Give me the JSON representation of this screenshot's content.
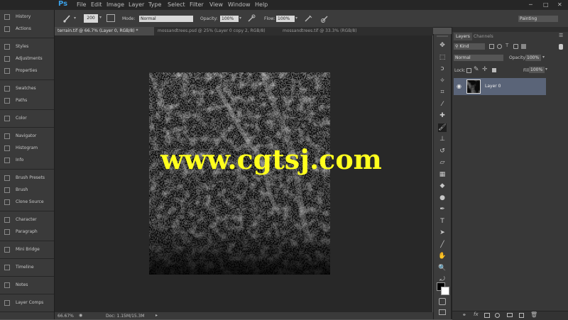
{
  "app": {
    "logo": "Ps"
  },
  "menu": [
    "File",
    "Edit",
    "Image",
    "Layer",
    "Type",
    "Select",
    "Filter",
    "View",
    "Window",
    "Help"
  ],
  "options": {
    "brush_size": "200",
    "mode_label": "Mode:",
    "mode_value": "Normal",
    "opacity_label": "Opacity:",
    "opacity_value": "100%",
    "flow_label": "Flow:",
    "flow_value": "100%",
    "workspace": "Painting"
  },
  "left_panel": {
    "items": [
      {
        "label": "History",
        "icon": "history-icon"
      },
      {
        "label": "Actions",
        "icon": "actions-icon"
      },
      {
        "label": "Styles",
        "icon": "styles-icon"
      },
      {
        "label": "Adjustments",
        "icon": "adjustments-icon"
      },
      {
        "label": "Properties",
        "icon": "properties-icon"
      },
      {
        "label": "Swatches",
        "icon": "swatches-icon"
      },
      {
        "label": "Paths",
        "icon": "paths-icon"
      },
      {
        "label": "Color",
        "icon": "color-icon"
      },
      {
        "label": "Navigator",
        "icon": "navigator-icon"
      },
      {
        "label": "Histogram",
        "icon": "histogram-icon"
      },
      {
        "label": "Info",
        "icon": "info-icon"
      },
      {
        "label": "Brush Presets",
        "icon": "brush-presets-icon"
      },
      {
        "label": "Brush",
        "icon": "brush-icon"
      },
      {
        "label": "Clone Source",
        "icon": "clone-source-icon"
      },
      {
        "label": "Character",
        "icon": "character-icon"
      },
      {
        "label": "Paragraph",
        "icon": "paragraph-icon"
      },
      {
        "label": "Mini Bridge",
        "icon": "mini-bridge-icon"
      },
      {
        "label": "Timeline",
        "icon": "timeline-icon"
      },
      {
        "label": "Notes",
        "icon": "notes-icon"
      },
      {
        "label": "Layer Comps",
        "icon": "layer-comps-icon"
      }
    ]
  },
  "tabs": [
    {
      "label": "terrain.tif @ 66.7% (Layer 0, RGB/8) *",
      "active": true
    },
    {
      "label": "mossandtrees.psd @ 25% (Layer 0 copy 2, RGB/8)",
      "active": false
    },
    {
      "label": "mossandtrees.tif @ 33.3% (RGB/8)",
      "active": false
    }
  ],
  "canvas": {
    "watermark": "www.cgtsj.com"
  },
  "status": {
    "zoom": "66.67%",
    "doc": "Doc: 1.15M/15.3M"
  },
  "layers_panel": {
    "tabs": [
      "Layers",
      "Channels"
    ],
    "kind_filter": "Kind",
    "blend_mode": "Normal",
    "opacity_label": "Opacity:",
    "opacity_value": "100%",
    "lock_label": "Lock:",
    "fill_label": "Fill:",
    "fill_value": "100%",
    "layer_name": "Layer 0"
  }
}
